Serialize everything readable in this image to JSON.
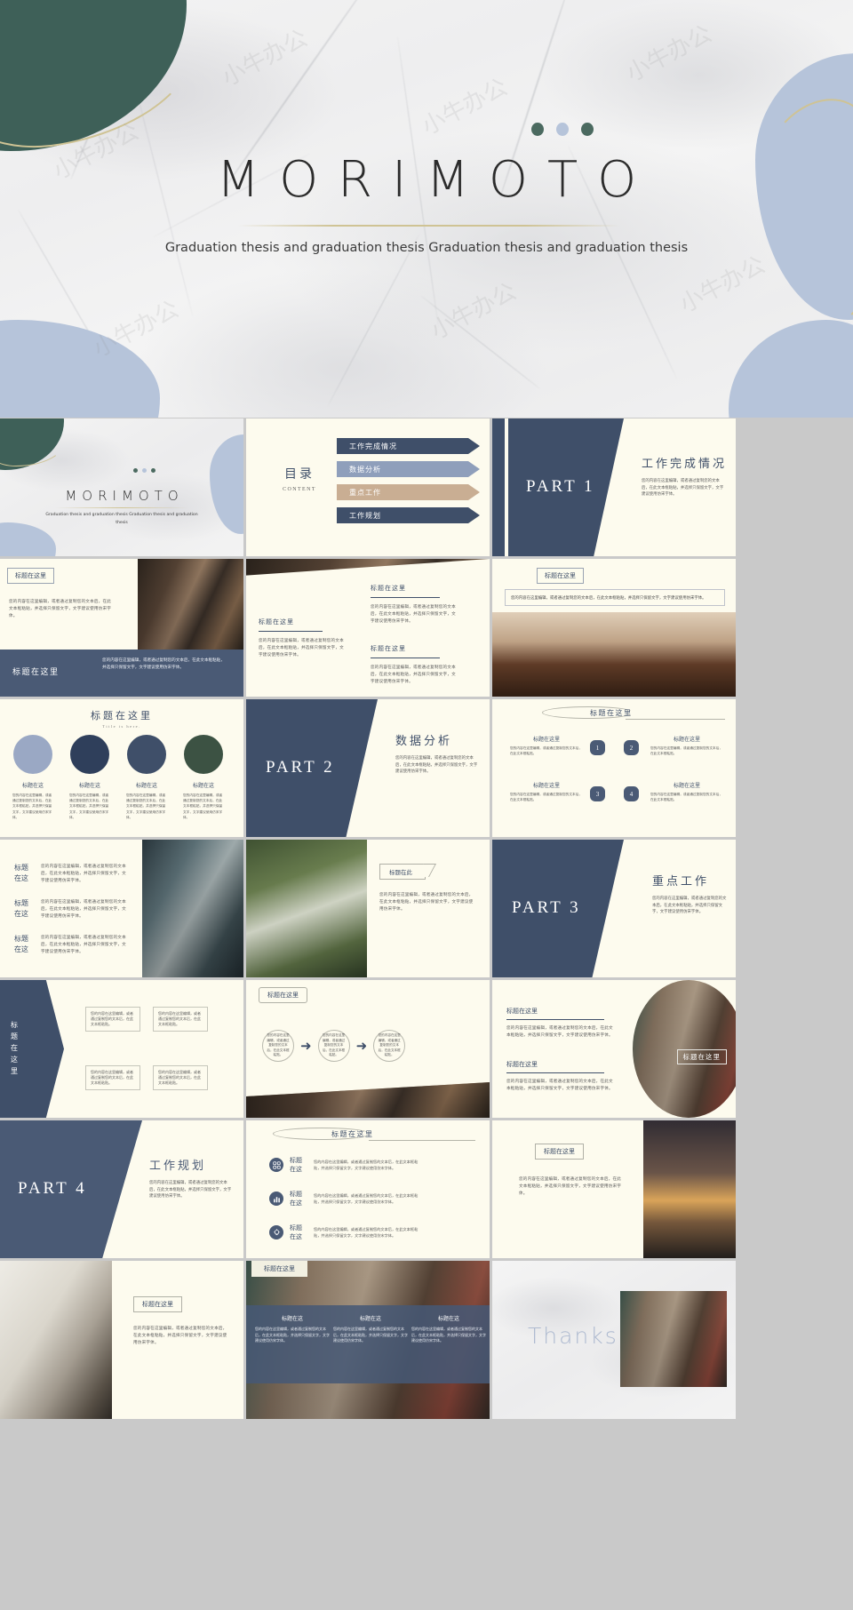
{
  "hero": {
    "title": "MORIMOTO",
    "subtitle": "Graduation thesis and graduation thesis  Graduation thesis and graduation thesis",
    "dots": [
      "#4b6a60",
      "#b6c4da",
      "#4b6a60"
    ],
    "watermark": "小牛办公"
  },
  "palette": {
    "navy": "#3f4f69",
    "navy_light": "#8f9fbb",
    "tan": "#c9ae93",
    "green": "#3e6058",
    "blue_grey": "#b6c4da",
    "cream": "#fdfbee",
    "gold": "#cfc394"
  },
  "common": {
    "title_cn": "标题在这里",
    "title_cn_short": "标题在这",
    "title_cn_here": "标题在此",
    "title_en": "Title is here.",
    "body_cn": "您的内容在这里编辑，或者通过复制您的文本后，在此文本框粘贴，并选择只保留文字，文字建议使用仿宋字体。",
    "body_cn_short": "您的内容在这里编辑，或者通过复制您的文本后，在此文本框粘贴。",
    "body_cn_mini": "您的内容在这里编辑，或者通过复制您的文本后，在此文本框粘贴。"
  },
  "slides": [
    {
      "id": "cover-thumb",
      "name": "cover-thumbnail",
      "title": "MORIMOTO",
      "subtitle": "Graduation thesis and graduation thesis  Graduation thesis and graduation thesis"
    },
    {
      "id": "toc",
      "name": "table-of-contents",
      "heading": "目录",
      "heading_en": "CONTENT",
      "items": [
        {
          "label": "工作完成情况",
          "color": "#3f4f69"
        },
        {
          "label": "数据分析",
          "color": "#8f9fbb"
        },
        {
          "label": "重点工作",
          "color": "#c9ae93"
        },
        {
          "label": "工作规划",
          "color": "#3f4f69"
        }
      ]
    },
    {
      "id": "part1",
      "name": "section-divider-part-1",
      "part": "PART  1",
      "title": "工作完成情况",
      "body": "您的内容在这里编辑，或者通过复制您的文本后，在此文本框粘贴，并选择只保留文字，文字建议使用仿宋字体。"
    },
    {
      "id": "s4",
      "name": "content-photo-left",
      "title": "标题在这里",
      "title2": "标题在这里",
      "body": "您的内容在这里编辑，或者通过复制您的文本后，在此文本框粘贴，并选择只保留文字，文字建议使用仿宋字体。",
      "body2": "您的内容在这里编辑，或者通过复制您的文本后，在此文本框粘贴，并选择只保留文字，文字建议使用仿宋字体。"
    },
    {
      "id": "s5",
      "name": "content-two-column-diagonal",
      "title1": "标题在这里",
      "title2": "标题在这里",
      "title3": "标题在这里",
      "body1": "您的内容在这里编辑，或者通过复制您的文本后，在此文本框粘贴，并选择只保留文字，文字建议使用仿宋字体。",
      "body2": "您的内容在这里编辑，或者通过复制您的文本后，在此文本框粘贴，并选择只保留文字，文字建议使用仿宋字体。",
      "body3": "您的内容在这里编辑，或者通过复制您的文本后，在此文本框粘贴，并选择只保留文字，文字建议使用仿宋字体。"
    },
    {
      "id": "s6",
      "name": "content-photo-bottom",
      "title": "标题在这里",
      "body": "您的内容在这里编辑，或者通过复制您的文本后，在此文本框粘贴，并选择只保留文字，文字建议使用仿宋字体。"
    },
    {
      "id": "s7",
      "name": "four-circles-slide",
      "heading": "标题在这里",
      "heading_en": "Title is here.",
      "circles": [
        {
          "color": "#9aa8c4",
          "label": "标题在这",
          "body": "您的内容在这里编辑，或者通过复制您的文本后，在此文本框粘贴，并选择只保留文字，文字建议使用仿宋字体。"
        },
        {
          "color": "#2f3f5b",
          "label": "标题在这",
          "body": "您的内容在这里编辑，或者通过复制您的文本后，在此文本框粘贴，并选择只保留文字，文字建议使用仿宋字体。"
        },
        {
          "color": "#3f4f69",
          "label": "标题在这",
          "body": "您的内容在这里编辑，或者通过复制您的文本后，在此文本框粘贴，并选择只保留文字，文字建议使用仿宋字体。"
        },
        {
          "color": "#3c5243",
          "label": "标题在这",
          "body": "您的内容在这里编辑，或者通过复制您的文本后，在此文本框粘贴，并选择只保留文字，文字建议使用仿宋字体。"
        }
      ]
    },
    {
      "id": "part2",
      "name": "section-divider-part-2",
      "part": "PART  2",
      "title": "数据分析",
      "body": "您的内容在这里编辑，或者通过复制您的文本后，在此文本框粘贴，并选择只保留文字，文字建议使用仿宋字体。"
    },
    {
      "id": "s9",
      "name": "numbered-steps-slide",
      "heading": "标题在这里",
      "steps": [
        {
          "num": "1",
          "label": "标题在这里",
          "body": "您的内容在这里编辑，或者通过复制您的文本后，在此文本框粘贴。"
        },
        {
          "num": "2",
          "label": "标题在这里",
          "body": "您的内容在这里编辑，或者通过复制您的文本后，在此文本框粘贴。"
        },
        {
          "num": "3",
          "label": "标题在这里",
          "body": "您的内容在这里编辑，或者通过复制您的文本后，在此文本框粘贴。"
        },
        {
          "num": "4",
          "label": "标题在这里",
          "body": "您的内容在这里编辑，或者通过复制您的文本后，在此文本框粘贴。"
        }
      ]
    },
    {
      "id": "s10",
      "name": "three-row-list-slide",
      "rows": [
        {
          "label": "标题在这",
          "body": "您的内容在这里编辑，或者通过复制您的文本后，在此文本框粘贴，并选择只保留文字，文字建议使用仿宋字体。"
        },
        {
          "label": "标题在这",
          "body": "您的内容在这里编辑，或者通过复制您的文本后，在此文本框粘贴，并选择只保留文字，文字建议使用仿宋字体。"
        },
        {
          "label": "标题在这",
          "body": "您的内容在这里编辑，或者通过复制您的文本后，在此文本框粘贴，并选择只保留文字，文字建议使用仿宋字体。"
        }
      ]
    },
    {
      "id": "s11",
      "name": "photo-with-arrow-tag-slide",
      "tag": "标题在此",
      "body": "您的内容在这里编辑，或者通过复制您的文本后，在此文本框粘贴，并选择只保留文字，文字建议使用仿宋字体。"
    },
    {
      "id": "part3",
      "name": "section-divider-part-3",
      "part": "PART  3",
      "title": "重点工作",
      "body": "您的内容在这里编辑，或者通过复制您的文本后，在此文本框粘贴，并选择只保留文字，文字建议使用仿宋字体。"
    },
    {
      "id": "s13",
      "name": "big-arrow-four-boxes-slide",
      "arrow_label": "标题在这里",
      "boxes": [
        "您的内容在这里编辑，或者通过复制您的文本后，在此文本框粘贴。",
        "您的内容在这里编辑，或者通过复制您的文本后，在此文本框粘贴。",
        "您的内容在这里编辑，或者通过复制您的文本后，在此文本框粘贴。",
        "您的内容在这里编辑，或者通过复制您的文本后，在此文本框粘贴。"
      ]
    },
    {
      "id": "s14",
      "name": "process-flow-slide",
      "title": "标题在这里",
      "steps": [
        "您的内容在这里编辑，或者通过复制您的文本后，在此文本框粘贴。",
        "您的内容在这里编辑，或者通过复制您的文本后，在此文本框粘贴。",
        "您的内容在这里编辑，或者通过复制您的文本后，在此文本框粘贴。"
      ]
    },
    {
      "id": "s15",
      "name": "text-with-circle-photo-slide",
      "title1": "标题在这里",
      "title2": "标题在这里",
      "body1": "您的内容在这里编辑，或者通过复制您的文本后，在此文本框粘贴，并选择只保留文字，文字建议使用仿宋字体。",
      "body2": "您的内容在这里编辑，或者通过复制您的文本后，在此文本框粘贴，并选择只保留文字，文字建议使用仿宋字体。",
      "photo_caption": "标题在这里"
    },
    {
      "id": "part4",
      "name": "section-divider-part-4",
      "part": "PART  4",
      "title": "工作规划",
      "body": "您的内容在这里编辑，或者通过复制您的文本后，在此文本框粘贴，并选择只保留文字，文字建议使用仿宋字体。"
    },
    {
      "id": "s17",
      "name": "icon-list-slide",
      "heading": "标题在这里",
      "rows": [
        {
          "icon": "grid-icon",
          "glyph": "▦",
          "label": "标题在这",
          "body": "您的内容在这里编辑，或者通过复制您的文本后，在此文本框粘贴，并选择只保留文字，文字建议使用仿宋字体。"
        },
        {
          "icon": "bar-chart-icon",
          "glyph": "▥",
          "label": "标题在这",
          "body": "您的内容在这里编辑，或者通过复制您的文本后，在此文本框粘贴，并选择只保留文字，文字建议使用仿宋字体。"
        },
        {
          "icon": "lightbulb-icon",
          "glyph": "✹",
          "label": "标题在这",
          "body": "您的内容在这里编辑，或者通过复制您的文本后，在此文本框粘贴，并选择只保留文字，文字建议使用仿宋字体。"
        }
      ]
    },
    {
      "id": "s18",
      "name": "text-left-sunset-photo-slide",
      "title": "标题在这里",
      "body": "您的内容在这里编辑，或者通过复制您的文本后，在此文本框粘贴，并选择只保留文字，文字建议使用仿宋字体。"
    },
    {
      "id": "s19",
      "name": "vase-photo-text-slide",
      "title": "标题在这里",
      "body": "您的内容在这里编辑，或者通过复制您的文本后，在此文本框粘贴，并选择只保留文字，文字建议使用仿宋字体。"
    },
    {
      "id": "s20",
      "name": "three-card-overlay-slide",
      "tag": "标题在这里",
      "cards": [
        {
          "label": "标题在这",
          "body": "您的内容在这里编辑，或者通过复制您的文本后，在此文本框粘贴，并选择只保留文字，文字建议使用仿宋字体。"
        },
        {
          "label": "标题在这",
          "body": "您的内容在这里编辑，或者通过复制您的文本后，在此文本框粘贴，并选择只保留文字，文字建议使用仿宋字体。"
        },
        {
          "label": "标题在这",
          "body": "您的内容在这里编辑，或者通过复制您的文本后，在此文本框粘贴，并选择只保留文字，文字建议使用仿宋字体。"
        }
      ]
    },
    {
      "id": "thanks",
      "name": "thanks-slide",
      "title": "Thanks"
    }
  ]
}
